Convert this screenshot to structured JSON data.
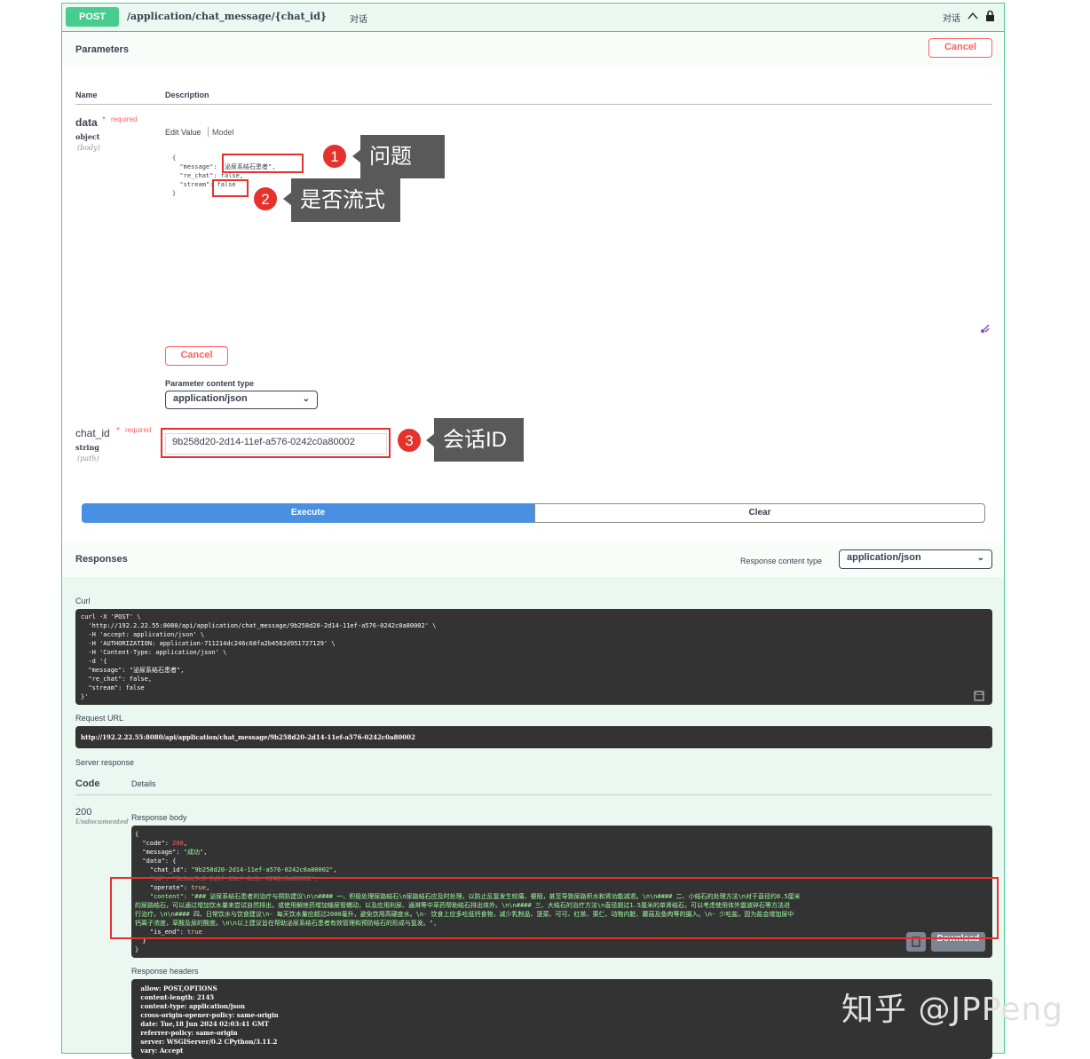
{
  "operation": {
    "method": "POST",
    "path": "/application/chat_message/{chat_id}",
    "summary": "对话",
    "tag_label": "对话"
  },
  "parameters": {
    "section_title": "Parameters",
    "cancel_label": "Cancel",
    "col_name": "Name",
    "col_description": "Description",
    "body_param": {
      "name": "data",
      "required_star": "*",
      "required_label": "required",
      "type": "object",
      "location": "(body)",
      "tab_edit": "Edit Value",
      "tab_model": "Model",
      "value": "{\n  \"message\": \"泌尿系结石患者\",\n  \"re_chat\": false,\n  \"stream\": false\n}",
      "cancel_label": "Cancel",
      "content_type_label": "Parameter content type",
      "content_type_value": "application/json"
    },
    "path_param": {
      "name": "chat_id",
      "required_star": "*",
      "required_label": "required",
      "type": "string",
      "location": "(path)",
      "value": "9b258d20-2d14-11ef-a576-0242c0a80002"
    }
  },
  "actions": {
    "execute_label": "Execute",
    "clear_label": "Clear"
  },
  "responses": {
    "section_title": "Responses",
    "content_type_label": "Response content type",
    "content_type_value": "application/json",
    "curl_label": "Curl",
    "curl": "curl -X 'POST' \\\n  'http://192.2.22.55:8080/api/application/chat_message/9b258d20-2d14-11ef-a576-0242c0a80002' \\\n  -H 'accept: application/json' \\\n  -H 'AUTHORIZATION: application-711214dc246c68fa2b4582d951727129' \\\n  -H 'Content-Type: application/json' \\\n  -d '{\n  \"message\": \"泌尿系结石患者\",\n  \"re_chat\": false,\n  \"stream\": false\n}'",
    "request_url_label": "Request URL",
    "request_url": "http://192.2.22.55:8080/api/application/chat_message/9b258d20-2d14-11ef-a576-0242c0a80002",
    "server_response_label": "Server response",
    "code_col": "Code",
    "details_col": "Details",
    "code": "200",
    "code_note": "Undocumented",
    "body_label": "Response body",
    "body_lines": [
      "{",
      "  \"code\": 200,",
      "  \"message\": \"成功\",",
      "  \"data\": {",
      "    \"chat_id\": \"9b258d20-2d14-11ef-a576-0242c0a80002\",",
      "    \"id\": \"3c1ae5c8-2d1f-11ef-8c2e-0242c0a80002\",",
      "    \"operate\": true,",
      "    \"content\": \"### 泌尿系结石患者的治疗与预防建议\\n\\n#### 一、积极处理尿路结石\\n尿路结石应及时处理，以防止反复发生绞痛、梗阻，甚至导致尿路积水和肾功能减退。\\n\\n#### 二、小结石的处理方法\\n对于直径约0.5厘米",
      "的尿路结石，可以通过增加饮水量来尝试自然排出，或使用解痉药增加输尿管蠕动，以及应用利尿、通淋等中草药帮助结石排出体外。\\n\\n#### 三、大结石的治疗方法\\n直径超过1.5厘米的单肾结石，可以考虑使用体外震波碎石等方法进",
      "行治疗。\\n\\n#### 四、日常饮水与饮食建议\\n- 每天饮水量应超过2000毫升，避免饮用高硬度水。\\n- 饮食上应多吃低钙食物，减少乳制品、菠菜、可可、红茶、栗仁、动物内脏、蘑菇及鱼肉等的摄入。\\n- 少吃盐，因为盐会增加尿中",
      "钙离子浓度，草酸及尿的酸度。\\n\\n以上建议旨在帮助泌尿系结石患者有效管理和预防结石的形成与复发。\",",
      "    \"is_end\": true",
      "  }",
      "}"
    ],
    "download_label": "Download",
    "headers_label": "Response headers",
    "headers_lines": [
      " allow: POST,OPTIONS",
      " content-length: 2145",
      " content-type: application/json",
      " cross-origin-opener-policy: same-origin",
      " date: Tue,18 Jun 2024 02:03:41 GMT",
      " referrer-policy: same-origin",
      " server: WSGIServer/0.2 CPython/3.11.2",
      " vary: Accept"
    ]
  },
  "annotations": {
    "callout1_num": "1",
    "callout1_text": "问题",
    "callout2_num": "2",
    "callout2_text": "是否流式",
    "callout3_num": "3",
    "callout3_text": "会话ID"
  },
  "watermark": "知乎 @JPPeng",
  "colors": {
    "post_green": "#49cc90",
    "cancel_red": "#ff6060",
    "execute_blue": "#4990e2",
    "annotation_red": "#e5322d",
    "callout_gray": "#595959"
  }
}
